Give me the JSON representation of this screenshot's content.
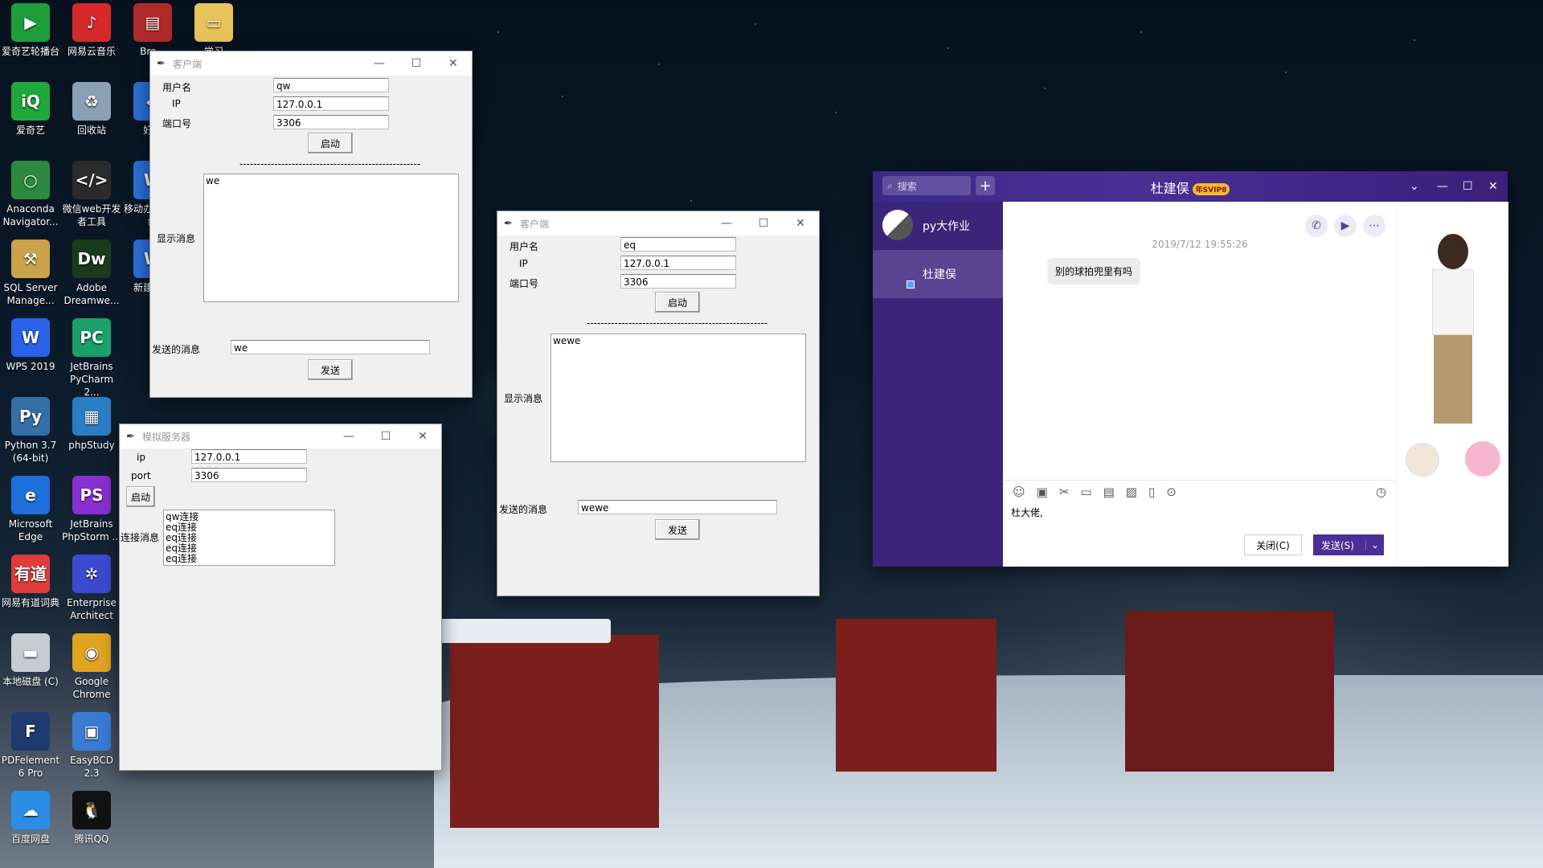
{
  "desktop": {
    "icons": [
      {
        "label": "爱奇艺轮播台",
        "icon": "iqiyi-carousel-icon",
        "color": "#1e9e3a",
        "glyph": "▶"
      },
      {
        "label": "网易云音乐",
        "icon": "netease-music-icon",
        "color": "#d62a2a",
        "glyph": "♪"
      },
      {
        "label": "Bre...",
        "icon": "book-stack-icon",
        "color": "#b02a2a",
        "glyph": "▤"
      },
      {
        "label": "学习",
        "icon": "folder-icon",
        "color": "#e8c35a",
        "glyph": "▭"
      },
      {
        "label": "爱奇艺",
        "icon": "iqiyi-icon",
        "color": "#1ea83c",
        "glyph": "iQ"
      },
      {
        "label": "回收站",
        "icon": "recycle-bin-icon",
        "color": "#8aa0b5",
        "glyph": "♻"
      },
      {
        "label": "好...",
        "icon": "app-icon",
        "color": "#2a6ed6",
        "glyph": "◆"
      },
      {
        "label": "Anaconda Navigator...",
        "icon": "anaconda-icon",
        "color": "#2b8a3e",
        "glyph": "○"
      },
      {
        "label": "微信web开发者工具",
        "icon": "wechat-devtools-icon",
        "color": "#2b2b2b",
        "glyph": "</>"
      },
      {
        "label": "移动办公化系统",
        "icon": "wps-doc-icon",
        "color": "#2a6ed6",
        "glyph": "W"
      },
      {
        "label": "SQL Server Manage...",
        "icon": "sql-server-icon",
        "color": "#c9a24a",
        "glyph": "⚒"
      },
      {
        "label": "Adobe Dreamwe...",
        "icon": "dreamweaver-icon",
        "color": "#1b3a1b",
        "glyph": "Dw"
      },
      {
        "label": "新建文档",
        "icon": "new-doc-icon",
        "color": "#2a6ed6",
        "glyph": "W"
      },
      {
        "label": "WPS 2019",
        "icon": "wps-icon",
        "color": "#2a62e8",
        "glyph": "W"
      },
      {
        "label": "JetBrains PyCharm 2...",
        "icon": "pycharm-icon",
        "color": "#1aa06b",
        "glyph": "PC"
      },
      {
        "label": "Python 3.7 (64-bit)",
        "icon": "python-icon",
        "color": "#356fa8",
        "glyph": "Py"
      },
      {
        "label": "phpStudy",
        "icon": "phpstudy-icon",
        "color": "#2a7ec4",
        "glyph": "▦"
      },
      {
        "label": "Microsoft Edge",
        "icon": "edge-icon",
        "color": "#1e6fd9",
        "glyph": "e"
      },
      {
        "label": "JetBrains PhpStorm ...",
        "icon": "phpstorm-icon",
        "color": "#8a2fd0",
        "glyph": "PS"
      },
      {
        "label": "网易有道词典",
        "icon": "youdao-icon",
        "color": "#e03c3c",
        "glyph": "有道"
      },
      {
        "label": "Enterprise Architect",
        "icon": "enterprise-architect-icon",
        "color": "#3a4bd0",
        "glyph": "✲"
      },
      {
        "label": "本地磁盘 (C)",
        "icon": "disk-icon",
        "color": "#c6ccd4",
        "glyph": "▬"
      },
      {
        "label": "Google Chrome",
        "icon": "chrome-icon",
        "color": "#e0a420",
        "glyph": "◉"
      },
      {
        "label": "PDFelement 6 Pro",
        "icon": "pdfelement-icon",
        "color": "#1e3a6e",
        "glyph": "F"
      },
      {
        "label": "EasyBCD 2.3",
        "icon": "easybcd-icon",
        "color": "#3a7bd5",
        "glyph": "▣"
      },
      {
        "label": "百度网盘",
        "icon": "baidu-netdisk-icon",
        "color": "#2a8ee6",
        "glyph": "☁"
      },
      {
        "label": "腾讯QQ",
        "icon": "qq-icon",
        "color": "#111",
        "glyph": "🐧"
      }
    ]
  },
  "client1": {
    "title": "客户端",
    "username_label": "用户名",
    "username": "qw",
    "ip_label": "IP",
    "ip": "127.0.0.1",
    "port_label": "端口号",
    "port": "3306",
    "start_label": "启动",
    "separator": "----------------------------------------------------",
    "display_label": "显示消息",
    "display_text": "we",
    "send_label_text": "发送的消息",
    "send_value": "we",
    "send_button": "发送"
  },
  "client2": {
    "title": "客户端",
    "username_label": "用户名",
    "username": "eq",
    "ip_label": "IP",
    "ip": "127.0.0.1",
    "port_label": "端口号",
    "port": "3306",
    "start_label": "启动",
    "separator": "----------------------------------------------------",
    "display_label": "显示消息",
    "display_text": "wewe",
    "send_label_text": "发送的消息",
    "send_value": "wewe",
    "send_button": "发送"
  },
  "server": {
    "title": "模拟服务器",
    "ip_label": "ip",
    "ip": "127.0.0.1",
    "port_label": "port",
    "port": "3306",
    "start_label": "启动",
    "log_label": "连接消息",
    "log_text": "qw连接\neq连接\neq连接\neq连接\neq连接"
  },
  "qq": {
    "search_placeholder": "搜索",
    "contact_name": "杜建俣",
    "svip_badge": "年SVIP8",
    "chats": [
      {
        "name": "py大作业"
      },
      {
        "name": "杜建俣"
      }
    ],
    "timestamp": "2019/7/12 19:55:26",
    "message": "别的球拍兜里有吗",
    "draft": "杜大佬,",
    "close_button": "关闭(C)",
    "send_button": "发送(S)",
    "accent": "#4a2f96"
  }
}
